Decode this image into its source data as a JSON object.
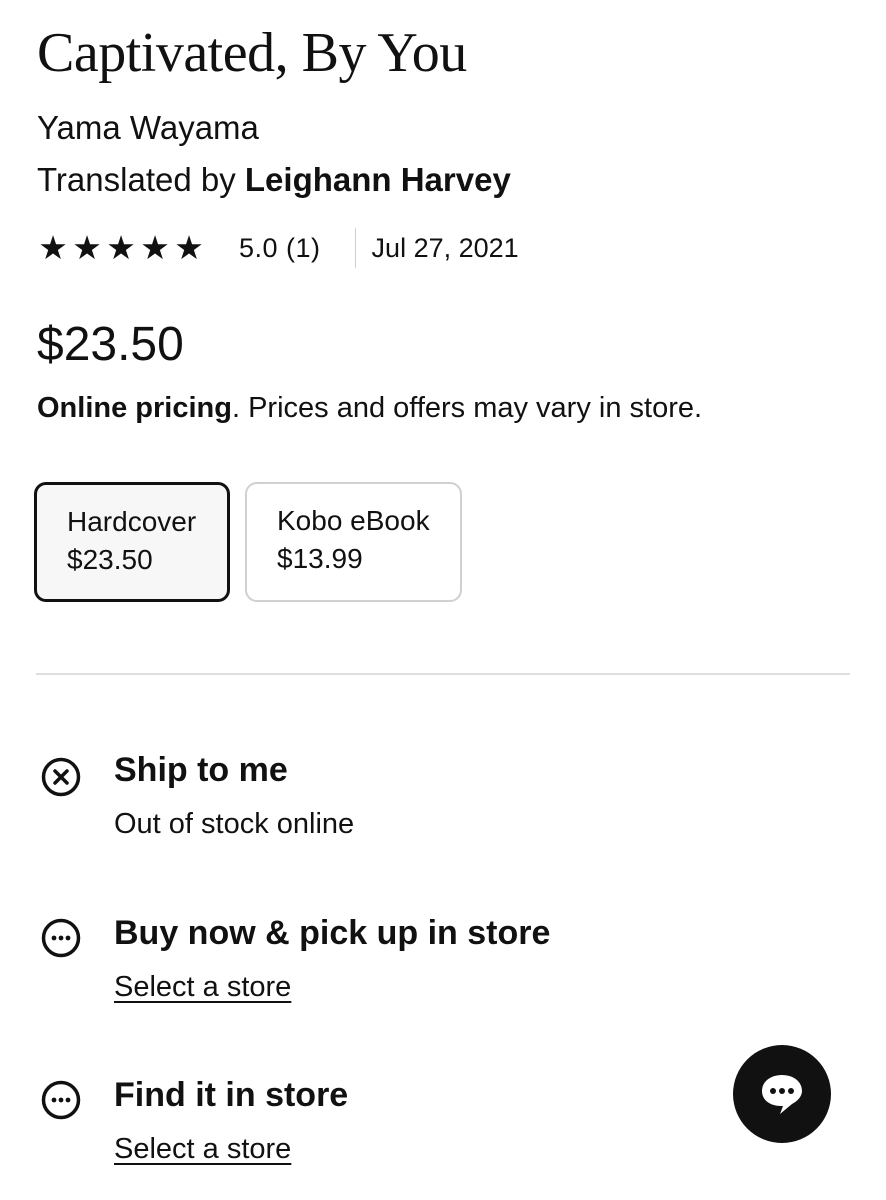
{
  "book": {
    "title": "Captivated, By You",
    "author": "Yama Wayama",
    "translated_prefix": "Translated by ",
    "translator": "Leighann Harvey"
  },
  "rating": {
    "stars": 5,
    "star_glyph": "★",
    "score_text": "5.0 (1)",
    "date": "Jul 27, 2021"
  },
  "pricing": {
    "price": "$23.50",
    "note_bold": "Online pricing",
    "note_rest": ". Prices and offers may vary in store."
  },
  "formats": [
    {
      "label": "Hardcover",
      "price": "$23.50",
      "selected": true
    },
    {
      "label": "Kobo eBook",
      "price": "$13.99",
      "selected": false
    }
  ],
  "fulfillment": [
    {
      "title": "Ship to me",
      "subtitle": "Out of stock online",
      "icon": "x-circle-icon"
    },
    {
      "title": "Buy now & pick up in store",
      "subtitle": "Select a store",
      "icon": "ellipsis-circle-icon"
    },
    {
      "title": "Find it in store",
      "subtitle": "Select a store",
      "icon": "ellipsis-circle-icon"
    }
  ],
  "chat": {
    "icon": "chat-bubble-icon"
  },
  "colors": {
    "text": "#111111",
    "selected_border": "#111111",
    "unselected_border": "#d0d0d0",
    "divider": "#dedede"
  }
}
